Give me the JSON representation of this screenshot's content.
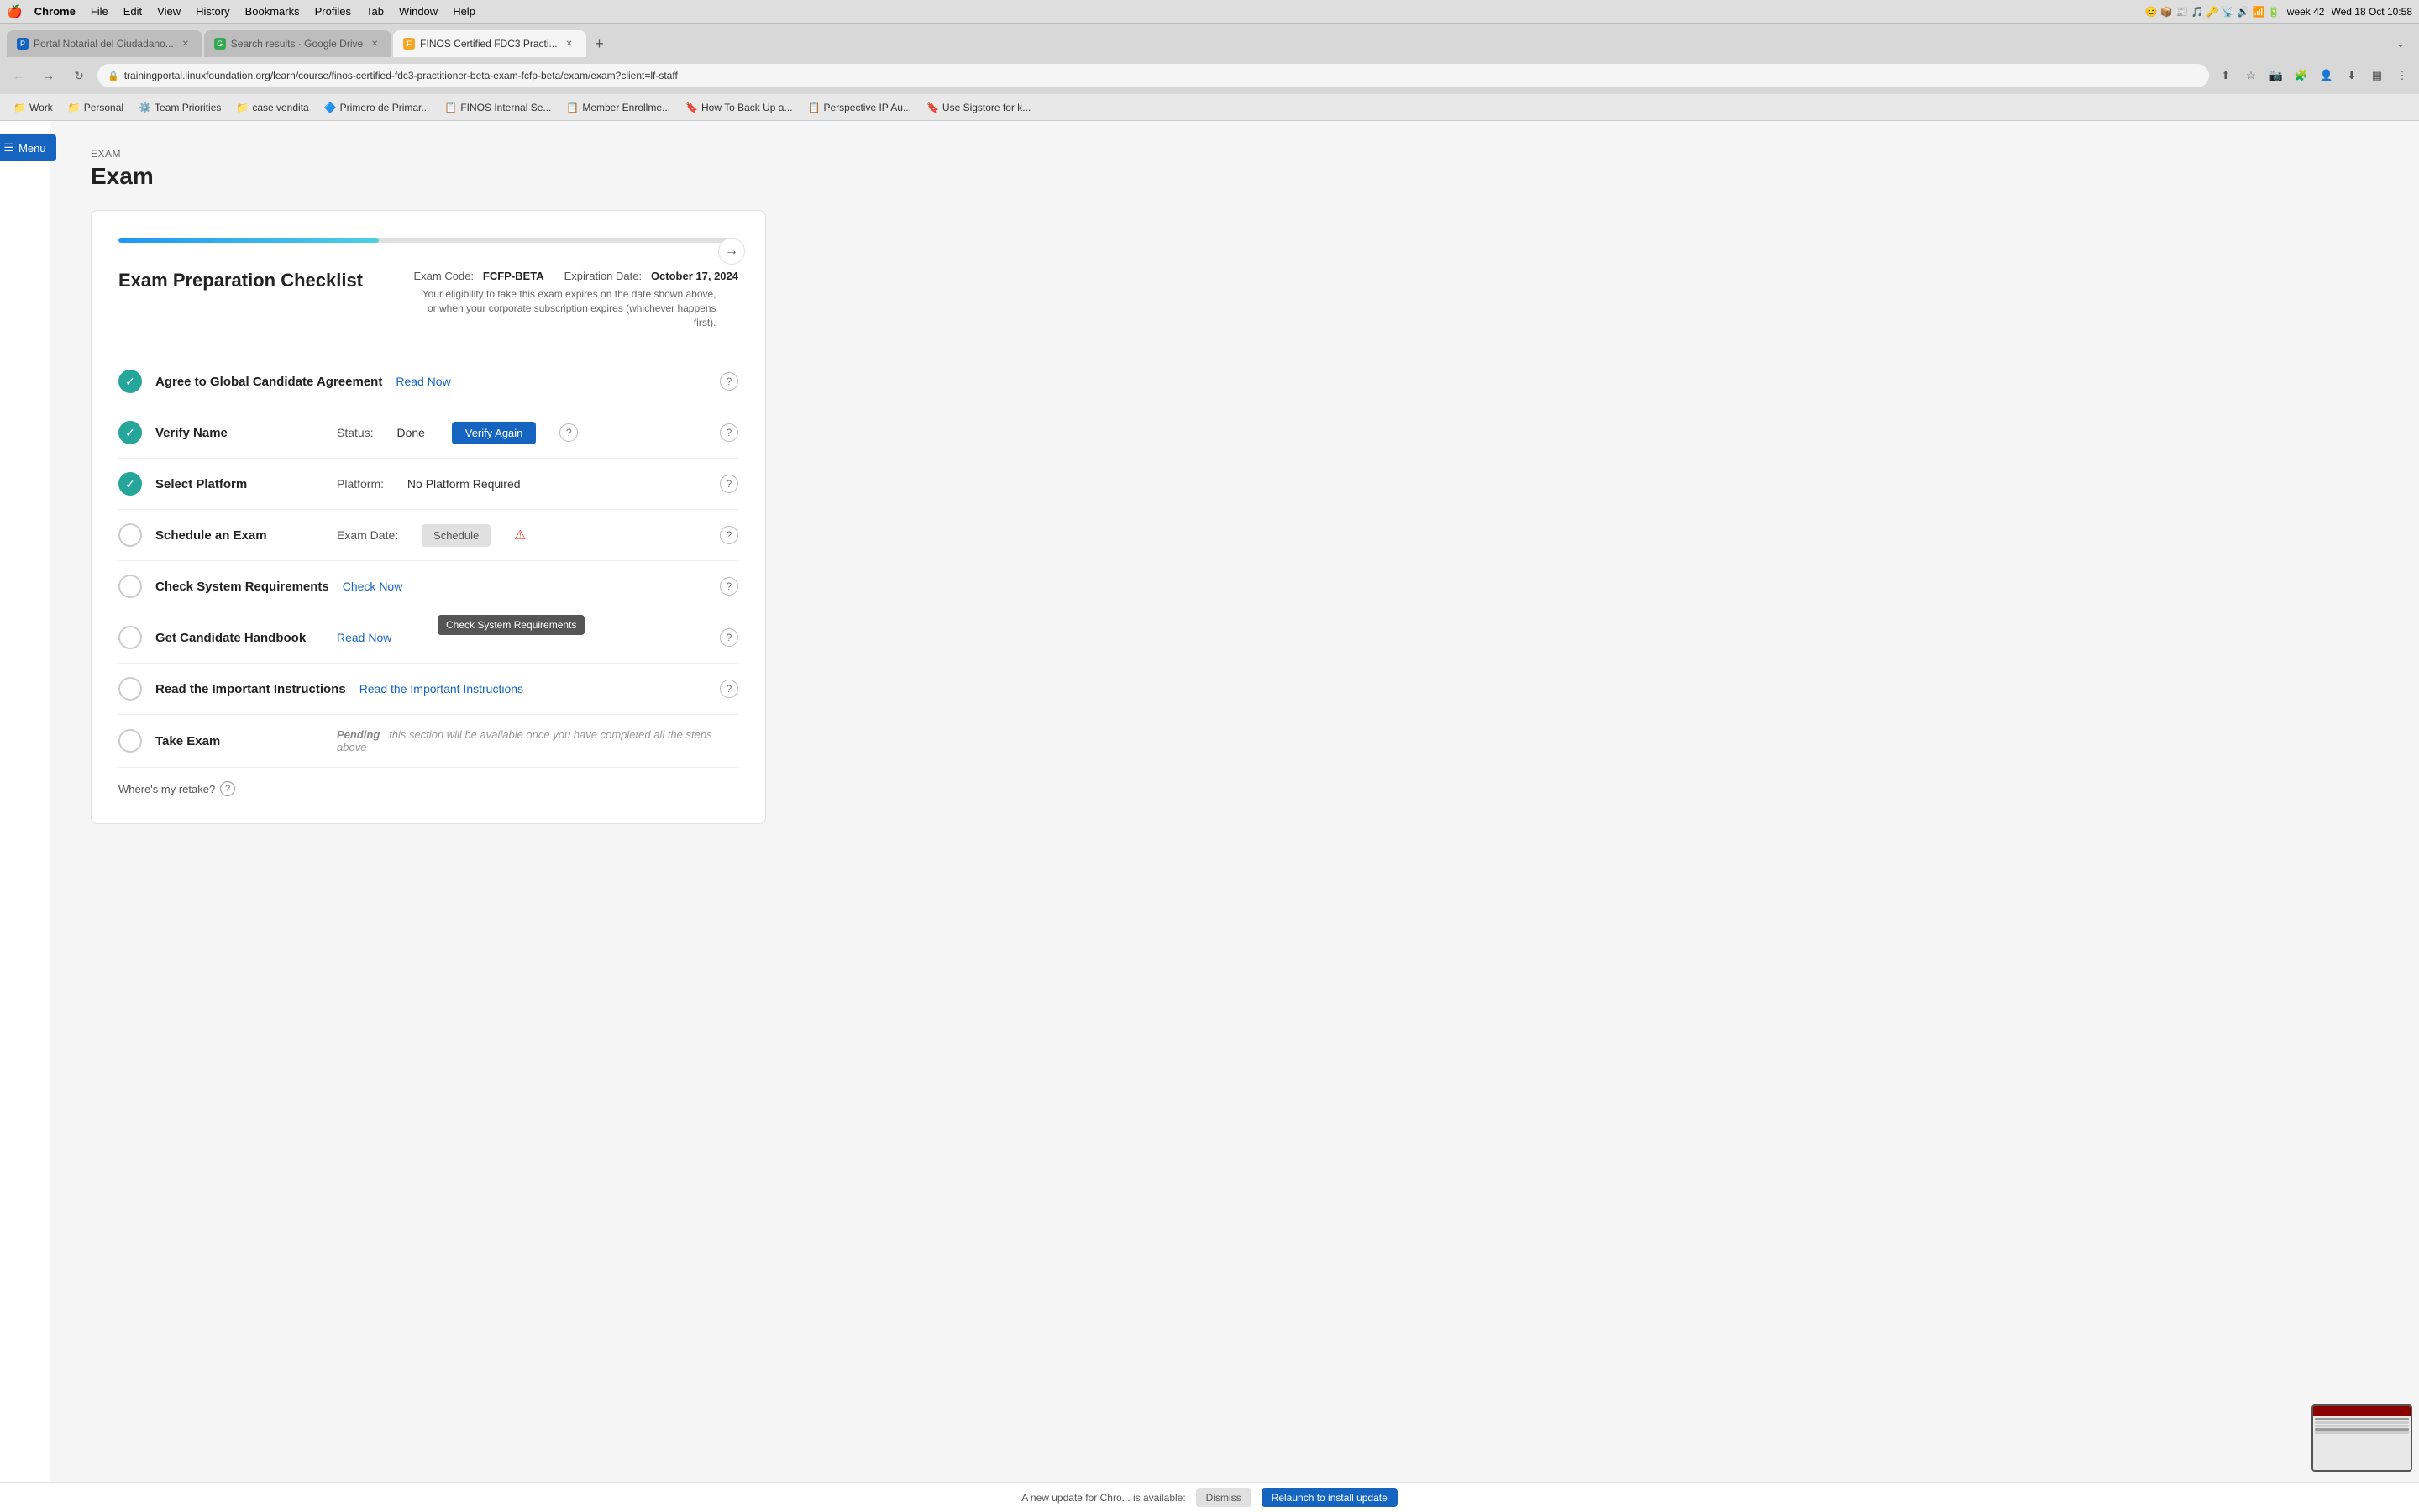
{
  "menubar": {
    "apple": "🍎",
    "items": [
      "Chrome",
      "File",
      "Edit",
      "View",
      "History",
      "Bookmarks",
      "Profiles",
      "Tab",
      "Window",
      "Help"
    ],
    "datetime": "Wed 18 Oct  10:58",
    "week": "week 42"
  },
  "browser": {
    "tabs": [
      {
        "id": "tab1",
        "label": "Portal Notarial del Ciudadano...",
        "favicon_color": "#1565c0",
        "active": false
      },
      {
        "id": "tab2",
        "label": "Search results · Google Drive",
        "favicon_color": "#34a853",
        "active": false
      },
      {
        "id": "tab3",
        "label": "FINOS Certified FDC3 Practi...",
        "favicon_color": "#f5a623",
        "active": true
      }
    ],
    "address": "trainingportal.linuxfoundation.org/learn/course/finos-certified-fdc3-practitioner-beta-exam-fcfp-beta/exam/exam?client=lf-staff"
  },
  "bookmarks": [
    {
      "id": "bm1",
      "icon": "📁",
      "label": "Work"
    },
    {
      "id": "bm2",
      "icon": "📁",
      "label": "Personal"
    },
    {
      "id": "bm3",
      "icon": "⚙️",
      "label": "Team Priorities"
    },
    {
      "id": "bm4",
      "icon": "📁",
      "label": "case vendita"
    },
    {
      "id": "bm5",
      "icon": "🔷",
      "label": "Primero de Primar..."
    },
    {
      "id": "bm6",
      "icon": "📋",
      "label": "FINOS Internal Se..."
    },
    {
      "id": "bm7",
      "icon": "📋",
      "label": "Member Enrollme..."
    },
    {
      "id": "bm8",
      "icon": "🔖",
      "label": "How To Back Up a..."
    },
    {
      "id": "bm9",
      "icon": "📋",
      "label": "Perspective IP Au..."
    },
    {
      "id": "bm10",
      "icon": "🔖",
      "label": "Use Sigstore for k..."
    }
  ],
  "sidebar": {
    "menu_label": "Menu"
  },
  "page": {
    "exam_section": "EXAM",
    "exam_title": "Exam",
    "checklist_title": "Exam Preparation Checklist",
    "exam_code_label": "Exam Code:",
    "exam_code_value": "FCFP-BETA",
    "expiry_label": "Expiration Date:",
    "expiry_value": "October 17, 2024",
    "eligibility_note": "Your eligibility to take this exam expires on the date shown above, or when your corporate subscription expires (whichever happens first).",
    "progress_percent": 42,
    "checklist_items": [
      {
        "id": "item1",
        "done": true,
        "name": "Agree to Global Candidate Agreement",
        "action_label": "Read Now",
        "action_type": "link"
      },
      {
        "id": "item2",
        "done": true,
        "name": "Verify Name",
        "status_label": "Status:",
        "status_value": "Done",
        "action_label": "Verify Again",
        "action_type": "button"
      },
      {
        "id": "item3",
        "done": true,
        "name": "Select Platform",
        "platform_label": "Platform:",
        "platform_value": "No Platform Required",
        "action_type": "none"
      },
      {
        "id": "item4",
        "done": false,
        "name": "Schedule an Exam",
        "date_label": "Exam Date:",
        "action_label": "Schedule",
        "action_type": "schedule",
        "has_warning": true
      },
      {
        "id": "item5",
        "done": false,
        "name": "Check System Requirements",
        "action_label": "Check Now",
        "action_type": "link",
        "tooltip": "Check System Requirements"
      },
      {
        "id": "item6",
        "done": false,
        "name": "Get Candidate Handbook",
        "action_label": "Read Now",
        "action_type": "link"
      },
      {
        "id": "item7",
        "done": false,
        "name": "Read the Important Instructions",
        "action_label": "Read the Important Instructions",
        "action_type": "link"
      },
      {
        "id": "item8",
        "done": false,
        "name": "Take Exam",
        "pending_bold": "Pending",
        "pending_text": "this section will be available once you have completed all the steps above",
        "action_type": "pending"
      }
    ],
    "retake_label": "Where's my retake?",
    "update_bar_text": "A new update for Chro... is available:",
    "update_now_label": "Relaunch to install update",
    "dismiss_label": "Dismiss"
  }
}
